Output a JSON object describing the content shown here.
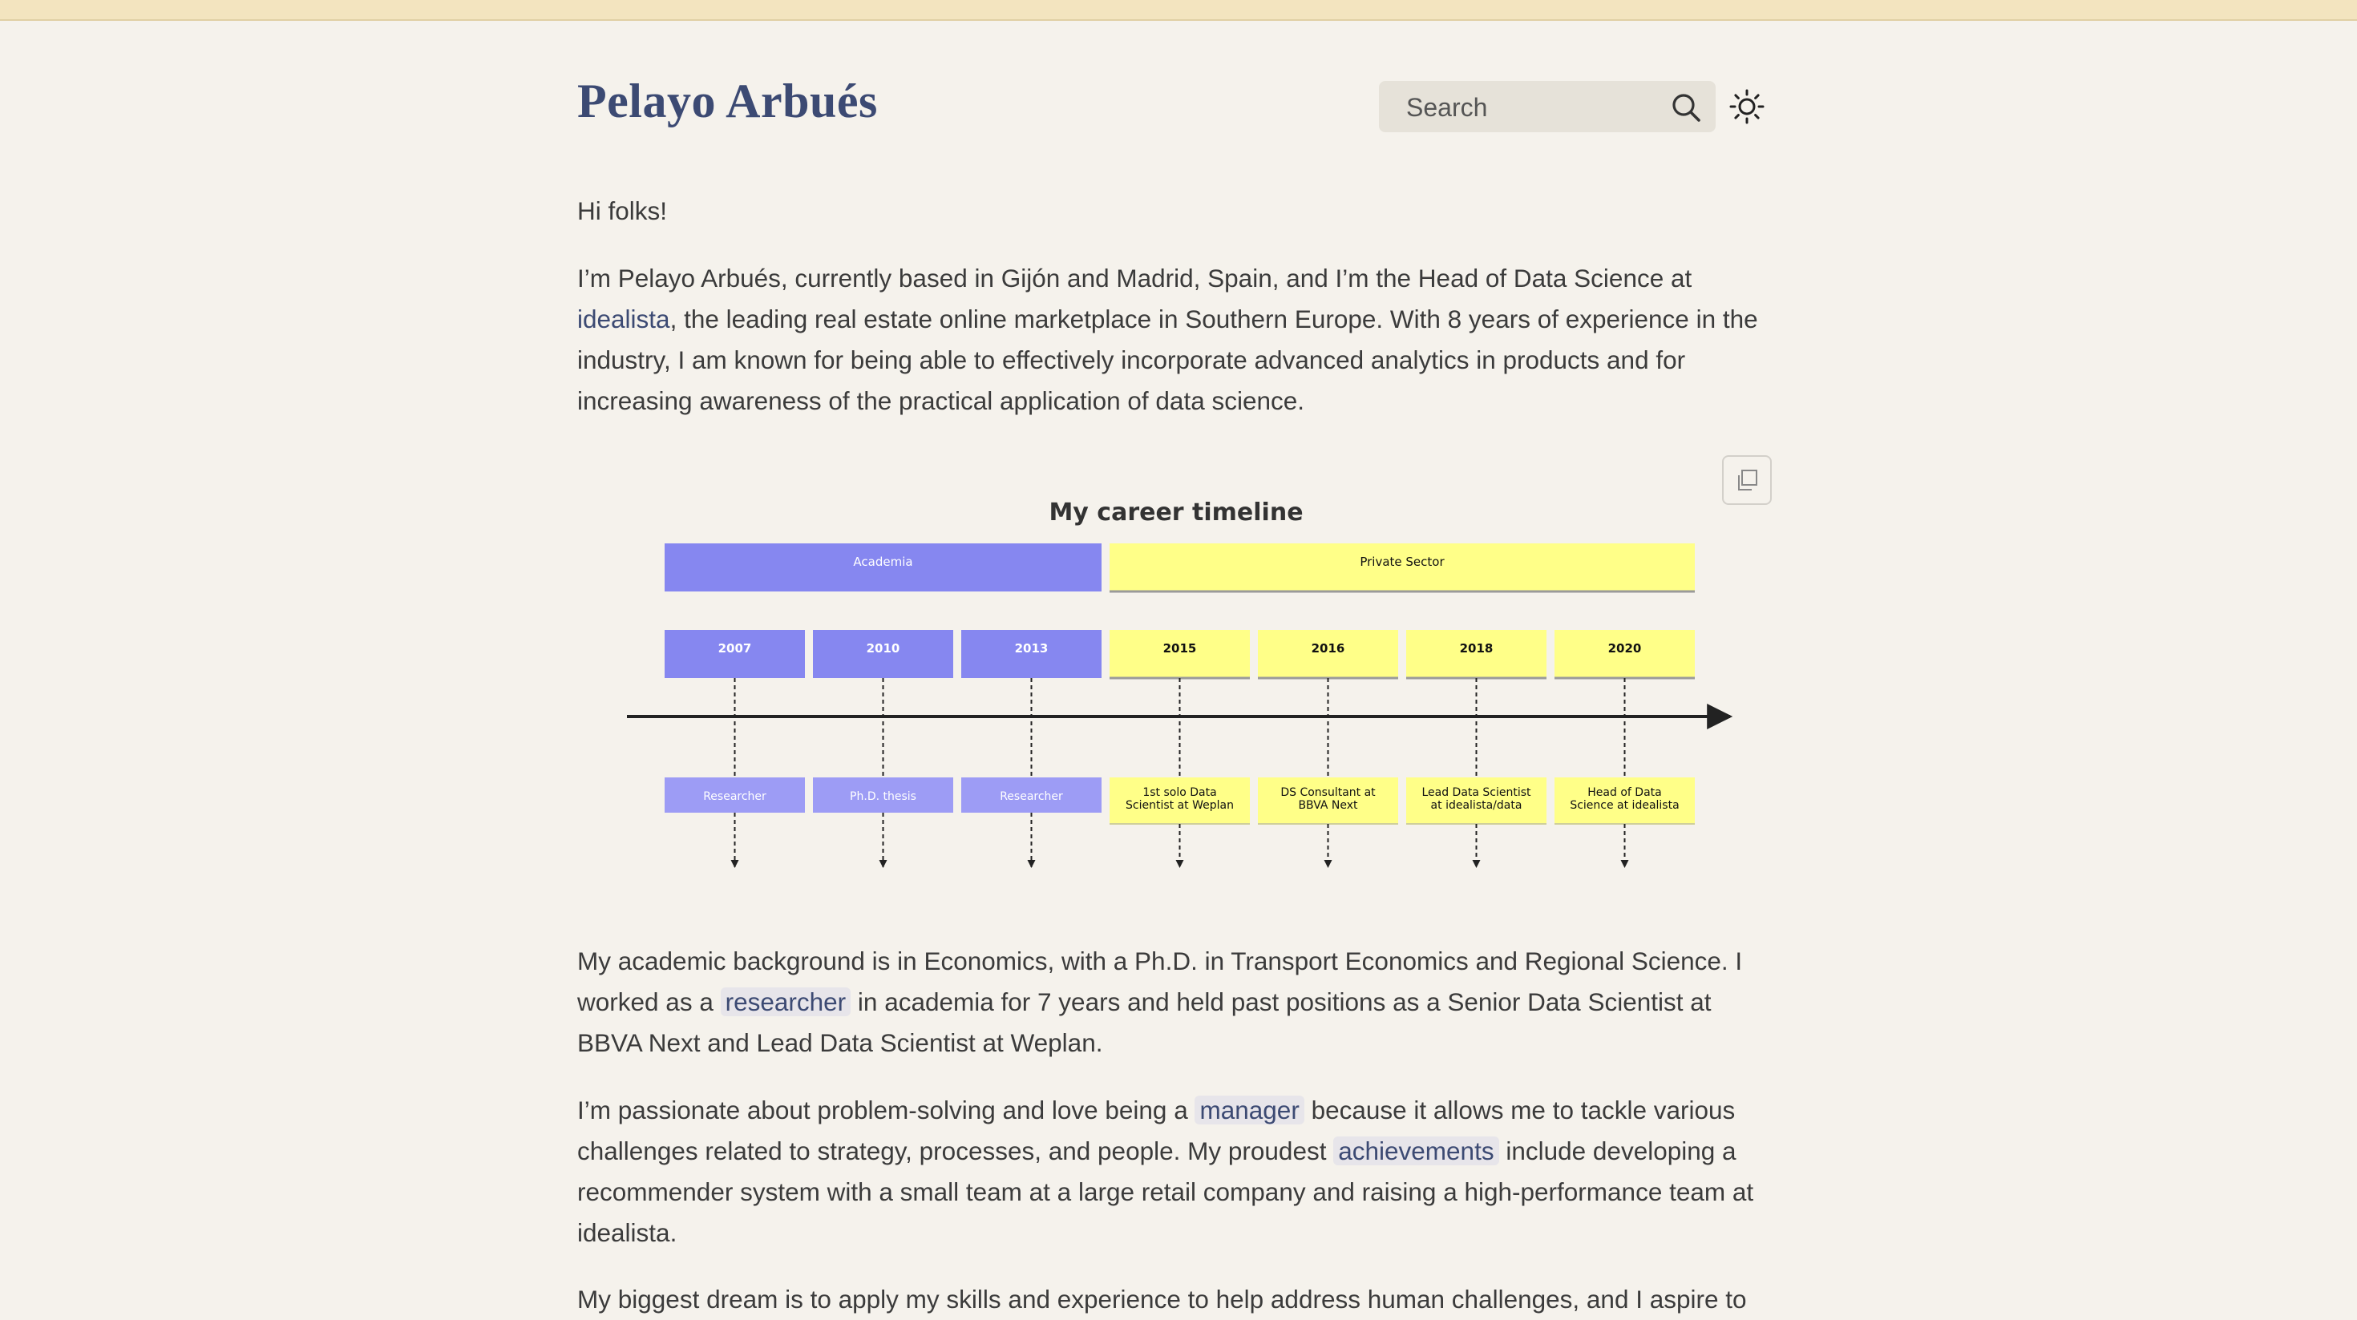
{
  "site": {
    "title": "Pelayo Arbués"
  },
  "search": {
    "placeholder": "Search"
  },
  "icons": {
    "search": "search-icon",
    "theme": "sun-icon",
    "copy": "copy-icon"
  },
  "colors": {
    "accent": "#3c4a73",
    "academia": "#8687f0",
    "academia_light": "#9d9cf5",
    "private": "#ffff88",
    "background": "#f5f2ec"
  },
  "content": {
    "greeting": "Hi folks!",
    "intro": {
      "before": "I’m Pelayo Arbués, currently based in Gijón and Madrid, Spain, and I’m the Head of Data Science at ",
      "link": "idealista",
      "after": ", the leading real estate online marketplace in Southern Europe. With 8 years of experience in the industry, I am known for being able to effectively incorporate advanced analytics in products and for increasing awareness of the practical application of data science."
    },
    "academic": {
      "before": "My academic background is in Economics, with a Ph.D. in Transport Economics and Regional Science. I worked as a ",
      "link": "researcher",
      "after": " in academia for 7 years and held past positions as a Senior Data Scientist at BBVA Next and Lead Data Scientist at Weplan."
    },
    "passion": {
      "before": "I’m passionate about problem-solving and love being a ",
      "link1": "manager",
      "middle": " because it allows me to tackle various challenges related to strategy, processes, and people. My proudest ",
      "link2": "achievements",
      "after": " include developing a recommender system with a small team at a large retail company and raising a high-performance team at idealista."
    },
    "dream": "My biggest dream is to apply my skills and experience to help address human challenges, and I aspire to"
  },
  "chart_data": {
    "type": "timeline",
    "title": "My career timeline",
    "sections": [
      {
        "name": "Academia",
        "color": "#8687f0",
        "events": [
          {
            "year": "2007",
            "event": "Researcher"
          },
          {
            "year": "2010",
            "event": "Ph.D. thesis"
          },
          {
            "year": "2013",
            "event": "Researcher"
          }
        ]
      },
      {
        "name": "Private Sector",
        "color": "#ffff88",
        "events": [
          {
            "year": "2015",
            "event": [
              "1st solo Data",
              "Scientist at Weplan"
            ]
          },
          {
            "year": "2016",
            "event": [
              "DS Consultant at",
              "BBVA Next"
            ]
          },
          {
            "year": "2018",
            "event": [
              "Lead Data Scientist",
              "at idealista/data"
            ]
          },
          {
            "year": "2020",
            "event": [
              "Head of Data",
              "Science at idealista"
            ]
          }
        ]
      }
    ]
  }
}
